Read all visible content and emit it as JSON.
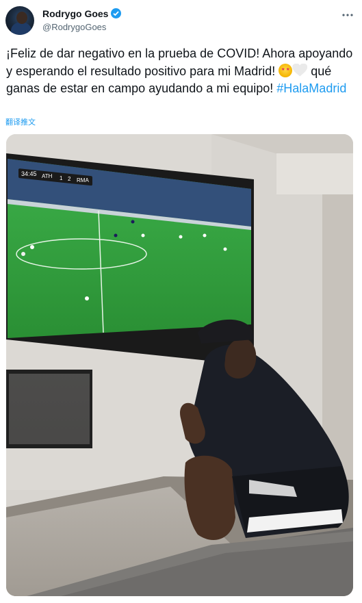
{
  "user": {
    "display_name": "Rodrygo Goes",
    "handle": "@RodrygoGoes"
  },
  "tweet": {
    "text_part1": "¡Feliz de dar negativo en la prueba de COVID! Ahora apoyando y esperando el resultado positivo para mi Madrid! ",
    "emojis": [
      "star-struck-emoji",
      "white-heart-emoji"
    ],
    "text_part2": " qué ganas de estar en campo ayudando a mi equipo! ",
    "hashtag": "#HalaMadrid",
    "translate_label": "翻译推文"
  },
  "photo": {
    "scoreboard": {
      "time": "34:45",
      "home": "ATH",
      "home_score": "1",
      "away_score": "2",
      "away": "RMA"
    },
    "colors": {
      "pitch": "#2fa23a",
      "hoodie": "#1a1d24",
      "wall": "#d6d3ce"
    }
  }
}
